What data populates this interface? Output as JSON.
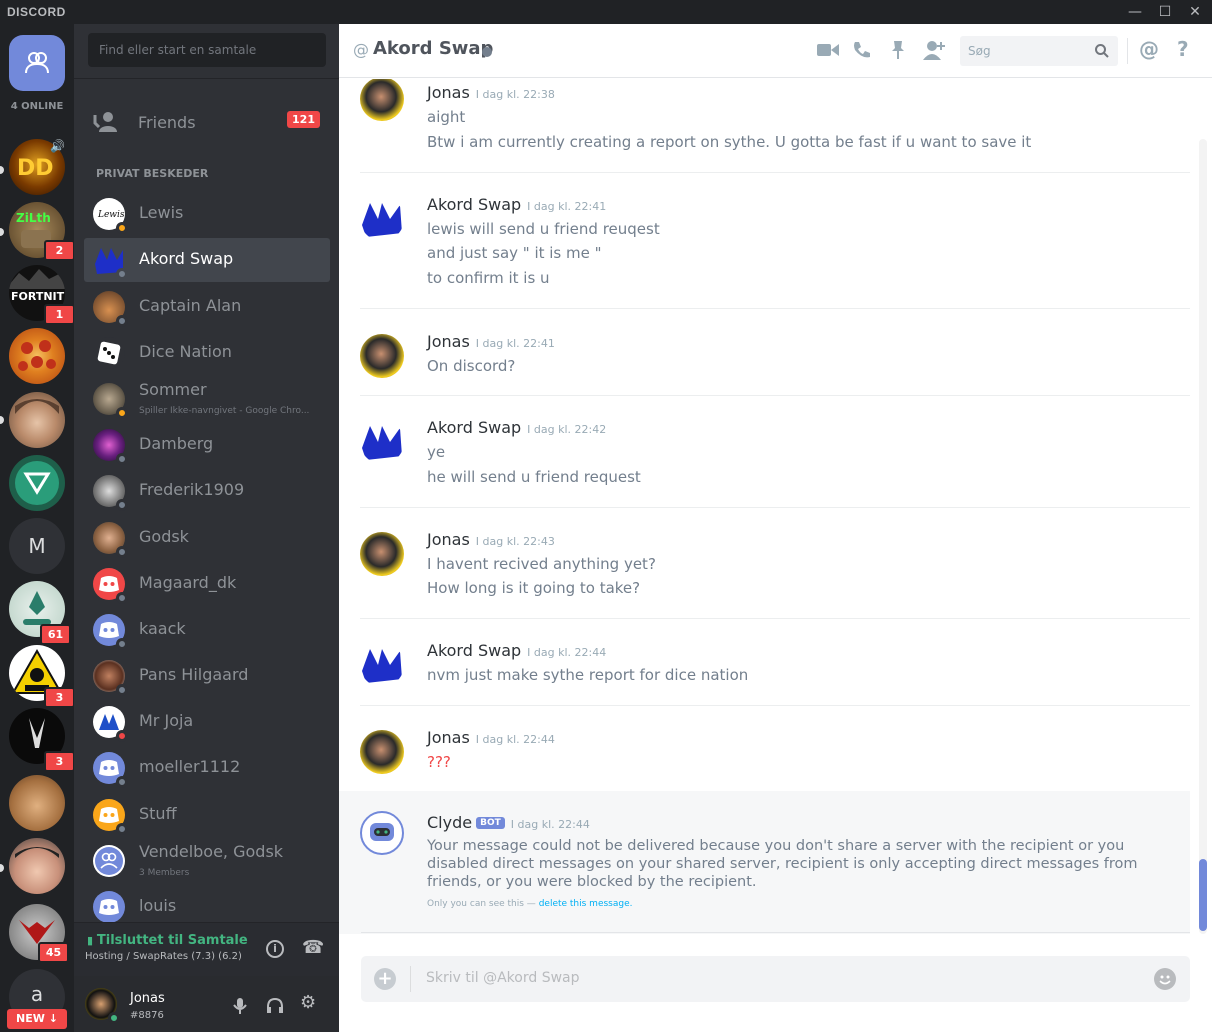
{
  "titlebar": {
    "brand": "DISCORD",
    "minimize": "—",
    "maximize": "☐",
    "close": "✕"
  },
  "guilds": {
    "online_label": "4 ONLINE",
    "items": [
      {
        "name": "DD",
        "badge": ""
      },
      {
        "name": "ZiLth",
        "badge": "2"
      },
      {
        "name": "FORTNITE",
        "badge": "1"
      },
      {
        "name": "Pizza",
        "badge": ""
      },
      {
        "name": "Face",
        "badge": ""
      },
      {
        "name": "V",
        "badge": ""
      },
      {
        "name": "M",
        "badge": ""
      },
      {
        "name": "Pump",
        "badge": "61"
      },
      {
        "name": "TOXIC",
        "badge": "3"
      },
      {
        "name": "Bunny",
        "badge": "3"
      },
      {
        "name": "Person",
        "badge": ""
      },
      {
        "name": "Person2",
        "badge": ""
      },
      {
        "name": "Redface",
        "badge": "45"
      },
      {
        "name": "a",
        "badge": ""
      }
    ],
    "m_letter": "M",
    "a_letter": "a",
    "new_label": "NEW ↓"
  },
  "sidebar": {
    "search_placeholder": "Find eller start en samtale",
    "friends_label": "Friends",
    "friends_badge": "121",
    "dm_header": "PRIVAT BESKEDER",
    "dms": [
      {
        "name": "Lewis",
        "sub": "",
        "status": "idle"
      },
      {
        "name": "Akord Swap",
        "sub": "",
        "status": "offline"
      },
      {
        "name": "Captain Alan",
        "sub": "",
        "status": "offline"
      },
      {
        "name": "Dice Nation",
        "sub": "",
        "status": "offline"
      },
      {
        "name": "Sommer",
        "sub": "Spiller Ikke-navngivet - Google Chro...",
        "status": "idle"
      },
      {
        "name": "Damberg",
        "sub": "",
        "status": "offline"
      },
      {
        "name": "Frederik1909",
        "sub": "",
        "status": "offline"
      },
      {
        "name": "Godsk",
        "sub": "",
        "status": "offline"
      },
      {
        "name": "Magaard_dk",
        "sub": "",
        "status": "offline"
      },
      {
        "name": "kaack",
        "sub": "",
        "status": "offline"
      },
      {
        "name": "Pans Hilgaard",
        "sub": "",
        "status": "offline"
      },
      {
        "name": "Mr Joja",
        "sub": "",
        "status": "dnd"
      },
      {
        "name": "moeller1112",
        "sub": "",
        "status": "offline"
      },
      {
        "name": "Stuff",
        "sub": "",
        "status": "offline"
      },
      {
        "name": "Vendelboe, Godsk",
        "sub": "3 Members",
        "status": ""
      },
      {
        "name": "louis",
        "sub": "",
        "status": "offline"
      }
    ],
    "voice_status": "Tilsluttet til Samtale",
    "voice_sub": "Hosting / SwapRates (7.3) (6.2)",
    "user_name": "Jonas",
    "user_discriminator": "#8876"
  },
  "chat": {
    "at": "@",
    "channel_name": "Akord Swap",
    "search_placeholder": "Søg",
    "messages": [
      {
        "author": "Jonas",
        "time": "I dag kl. 22:38",
        "lines": [
          "aight",
          "Btw i am currently creating a report on sythe. U gotta be fast if u want to save it"
        ]
      },
      {
        "author": "Akord Swap",
        "time": "I dag kl. 22:41",
        "lines": [
          "lewis will send u friend reuqest",
          "and just say \" it is me \"",
          "to confirm it is u"
        ]
      },
      {
        "author": "Jonas",
        "time": "I dag kl. 22:41",
        "lines": [
          "On discord?"
        ]
      },
      {
        "author": "Akord Swap",
        "time": "I dag kl. 22:42",
        "lines": [
          "ye",
          "he will send u friend request"
        ]
      },
      {
        "author": "Jonas",
        "time": "I dag kl. 22:43",
        "lines": [
          "I havent recived anything yet?",
          "How long is it going to take?"
        ]
      },
      {
        "author": "Akord Swap",
        "time": "I dag kl. 22:44",
        "lines": [
          "nvm just make sythe report for dice nation"
        ]
      },
      {
        "author": "Jonas",
        "time": "I dag kl. 22:44",
        "lines": [
          "???"
        ]
      }
    ],
    "clyde": {
      "author": "Clyde",
      "bot_tag": "BOT",
      "time": "I dag kl. 22:44",
      "text": "Your message could not be delivered because you don't share a server with the recipient or you disabled direct messages on your shared server, recipient is only accepting direct messages from friends, or you were blocked by the recipient.",
      "note_prefix": "Only you can see this —",
      "note_link": "delete this message."
    },
    "composer_placeholder": "Skriv til @Akord Swap"
  }
}
